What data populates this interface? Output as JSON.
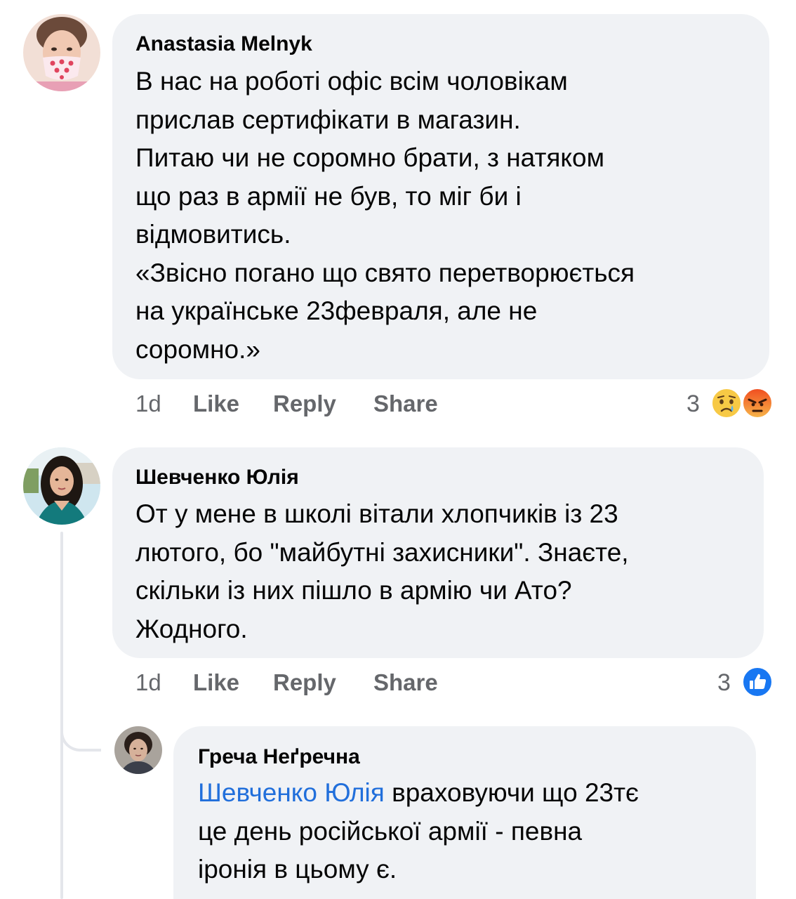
{
  "comments": [
    {
      "author": "Anastasia Melnyk",
      "text": "В нас на роботі офіс всім чоловікам\nприслав сертифікати в магазин.\nПитаю чи не соромно брати, з натяком\nщо раз в армії не був, то міг би і\nвідмовитись.\n«Звісно погано що свято перетворюється\nна українське 23февраля, але не\nсоромно.»",
      "time": "1d",
      "like": "Like",
      "reply": "Reply",
      "share": "Share",
      "reaction_count": "3",
      "reactions": [
        "sad-face-icon",
        "angry-face-icon"
      ]
    },
    {
      "author": "Шевченко Юлія",
      "text": "От у мене в школі вітали хлопчиків із 23\nлютого, бо \"майбутні захисники\". Знаєте,\nскільки із них пішло в армію чи Ато?\nЖодного.",
      "time": "1d",
      "like": "Like",
      "reply": "Reply",
      "share": "Share",
      "reaction_count": "3",
      "reactions": [
        "like-thumb-icon"
      ]
    }
  ],
  "reply": {
    "author": "Греча Неґречна",
    "mention": "Шевченко Юлія",
    "text": " враховуючи що 23тє\nце день російської армії - певна\nіронія в цьому є."
  },
  "colors": {
    "bubble": "#f0f2f5",
    "secondary_text": "#65676b",
    "mention": "#216fdb",
    "like_blue": "#1877f2",
    "reaction_yellow": "#f7c945",
    "reaction_angry": "#f04c1f"
  }
}
